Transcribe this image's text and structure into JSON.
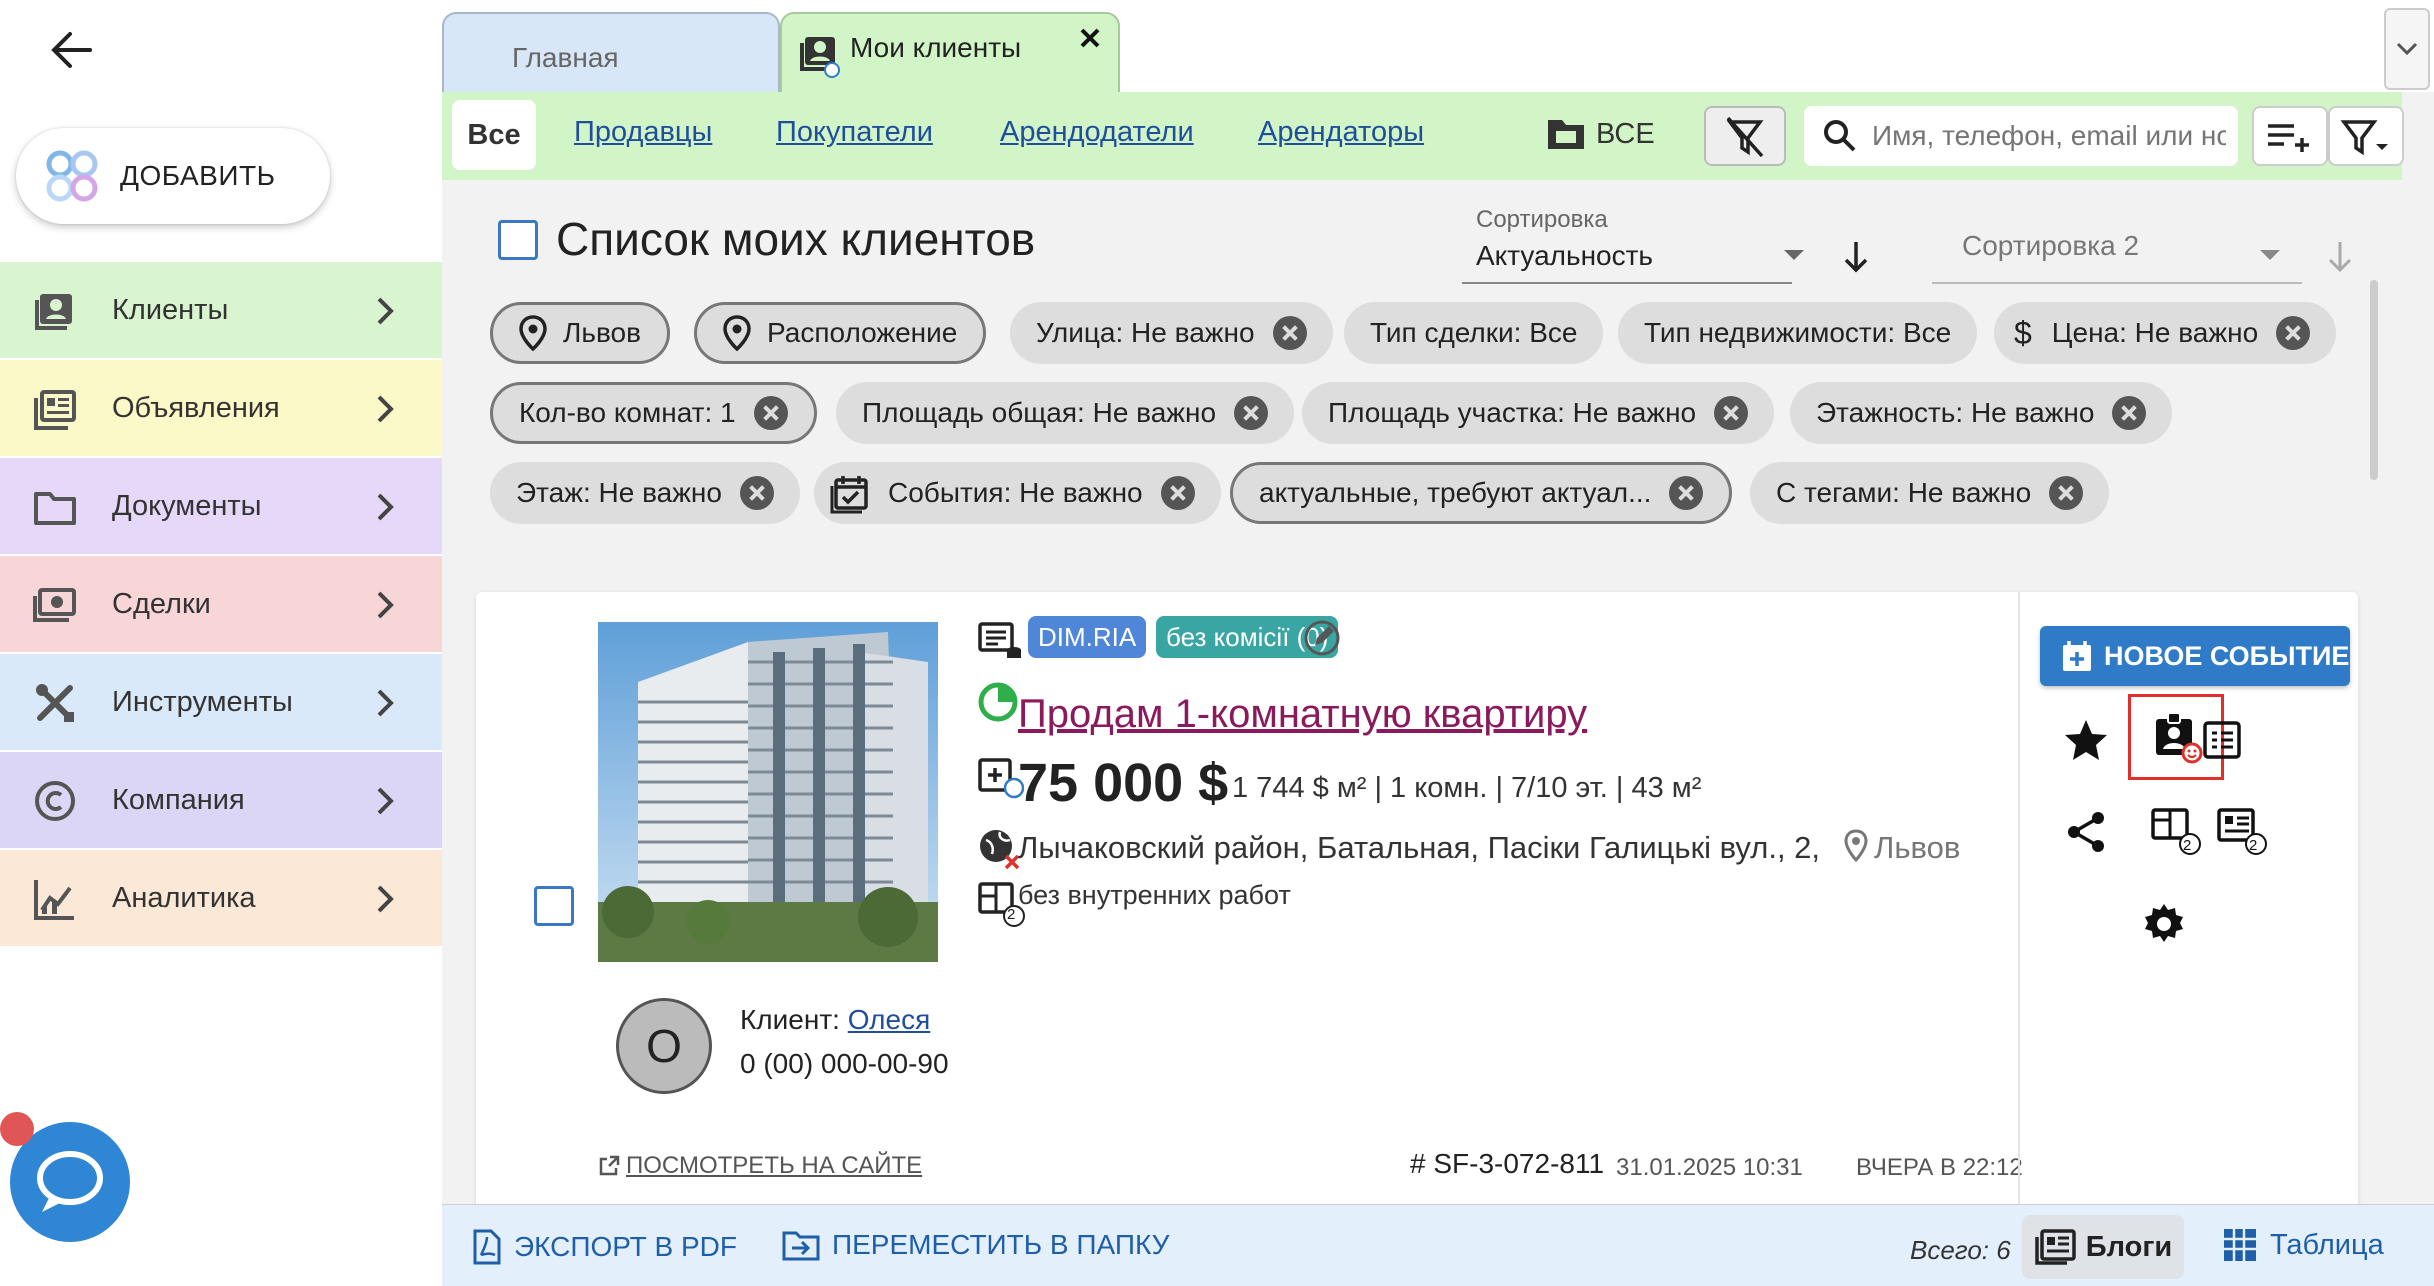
{
  "sidebar": {
    "add_label": "ДОБАВИТЬ",
    "items": [
      {
        "label": "Клиенты",
        "icon": "client-card-icon",
        "bg": "#d8f5cf"
      },
      {
        "label": "Объявления",
        "icon": "listing-icon",
        "bg": "#fbf9c8"
      },
      {
        "label": "Документы",
        "icon": "folder-icon",
        "bg": "#e6d8f8"
      },
      {
        "label": "Сделки",
        "icon": "deal-icon",
        "bg": "#f8d6d8"
      },
      {
        "label": "Инструменты",
        "icon": "tools-icon",
        "bg": "#d9e9fa"
      },
      {
        "label": "Компания",
        "icon": "copyright-icon",
        "bg": "#dcd6f6"
      },
      {
        "label": "Аналитика",
        "icon": "analytics-icon",
        "bg": "#fbe8d7"
      }
    ]
  },
  "tabs": {
    "home": "Главная",
    "clients": "Мои клиенты"
  },
  "filter_tabs": {
    "all": "Все",
    "items": [
      "Продавцы",
      "Покупатели",
      "Арендодатели",
      "Арендаторы"
    ],
    "folder": "ВСЕ"
  },
  "search": {
    "placeholder": "Имя, телефон, email или номер"
  },
  "list": {
    "title": "Список моих клиентов",
    "sort1_caption": "Сортировка",
    "sort1_value": "Актуальность",
    "sort2_value": "Сортировка 2"
  },
  "chips": [
    {
      "label": "Львов",
      "icon": "location-pin-icon",
      "outlined": true,
      "close": false
    },
    {
      "label": "Расположение",
      "icon": "location-pin-icon",
      "outlined": true,
      "close": false
    },
    {
      "label": "Улица: Не важно",
      "close": true
    },
    {
      "label": "Тип сделки: Все",
      "close": false
    },
    {
      "label": "Тип недвижимости: Все",
      "close": false
    },
    {
      "label": "Цена: Не важно",
      "icon": "dollar-icon",
      "close": true
    },
    {
      "label": "Кол-во комнат: 1",
      "outlined": true,
      "close": true
    },
    {
      "label": "Площадь общая: Не важно",
      "close": true
    },
    {
      "label": "Площадь участка: Не важно",
      "close": true
    },
    {
      "label": "Этажность: Не важно",
      "close": true
    },
    {
      "label": "Этаж: Не важно",
      "close": true
    },
    {
      "label": "События: Не важно",
      "icon": "calendar-check-icon",
      "close": true
    },
    {
      "label": "актуальные, требуют актуал...",
      "outlined": true,
      "close": true
    },
    {
      "label": "С тегами: Не важно",
      "close": true
    }
  ],
  "card": {
    "badge_source": "DIM.RIA",
    "badge_commission": "без комісії (0)",
    "title": "Продам 1-комнатную квартиру",
    "price": "75 000 $",
    "price_meta": "1 744 $ м² | 1 комн. | 7/10 эт. | 43 м²",
    "address": "Лычаковский район, Батальная, Пасіки Галицькі вул., 2,",
    "city": "Львов",
    "note": "без внутренних работ",
    "avatar_letter": "О",
    "client_label": "Клиент:",
    "client_name": "Олеся",
    "client_phone": "0 (00) 000-00-90",
    "view_site": "ПОСМОТРЕТЬ НА САЙТЕ",
    "id": "# SF-3-072-811",
    "date": "31.01.2025 10:31",
    "updated": "ВЧЕРА В 22:12",
    "new_event": "НОВОЕ СОБЫТИЕ",
    "count_a": "2",
    "count_b": "2",
    "count_c": "2"
  },
  "bottom": {
    "export_pdf": "ЭКСПОРТ В PDF",
    "move_folder": "ПЕРЕМЕСТИТЬ В ПАПКУ",
    "total": "Всего: 6",
    "view_blogs": "Блоги",
    "view_table": "Таблица"
  },
  "colors": {
    "accent": "#2f7bc7",
    "clients_green": "#d2f5c8",
    "title_link": "#8b1a5c",
    "highlight": "#e0302a"
  }
}
